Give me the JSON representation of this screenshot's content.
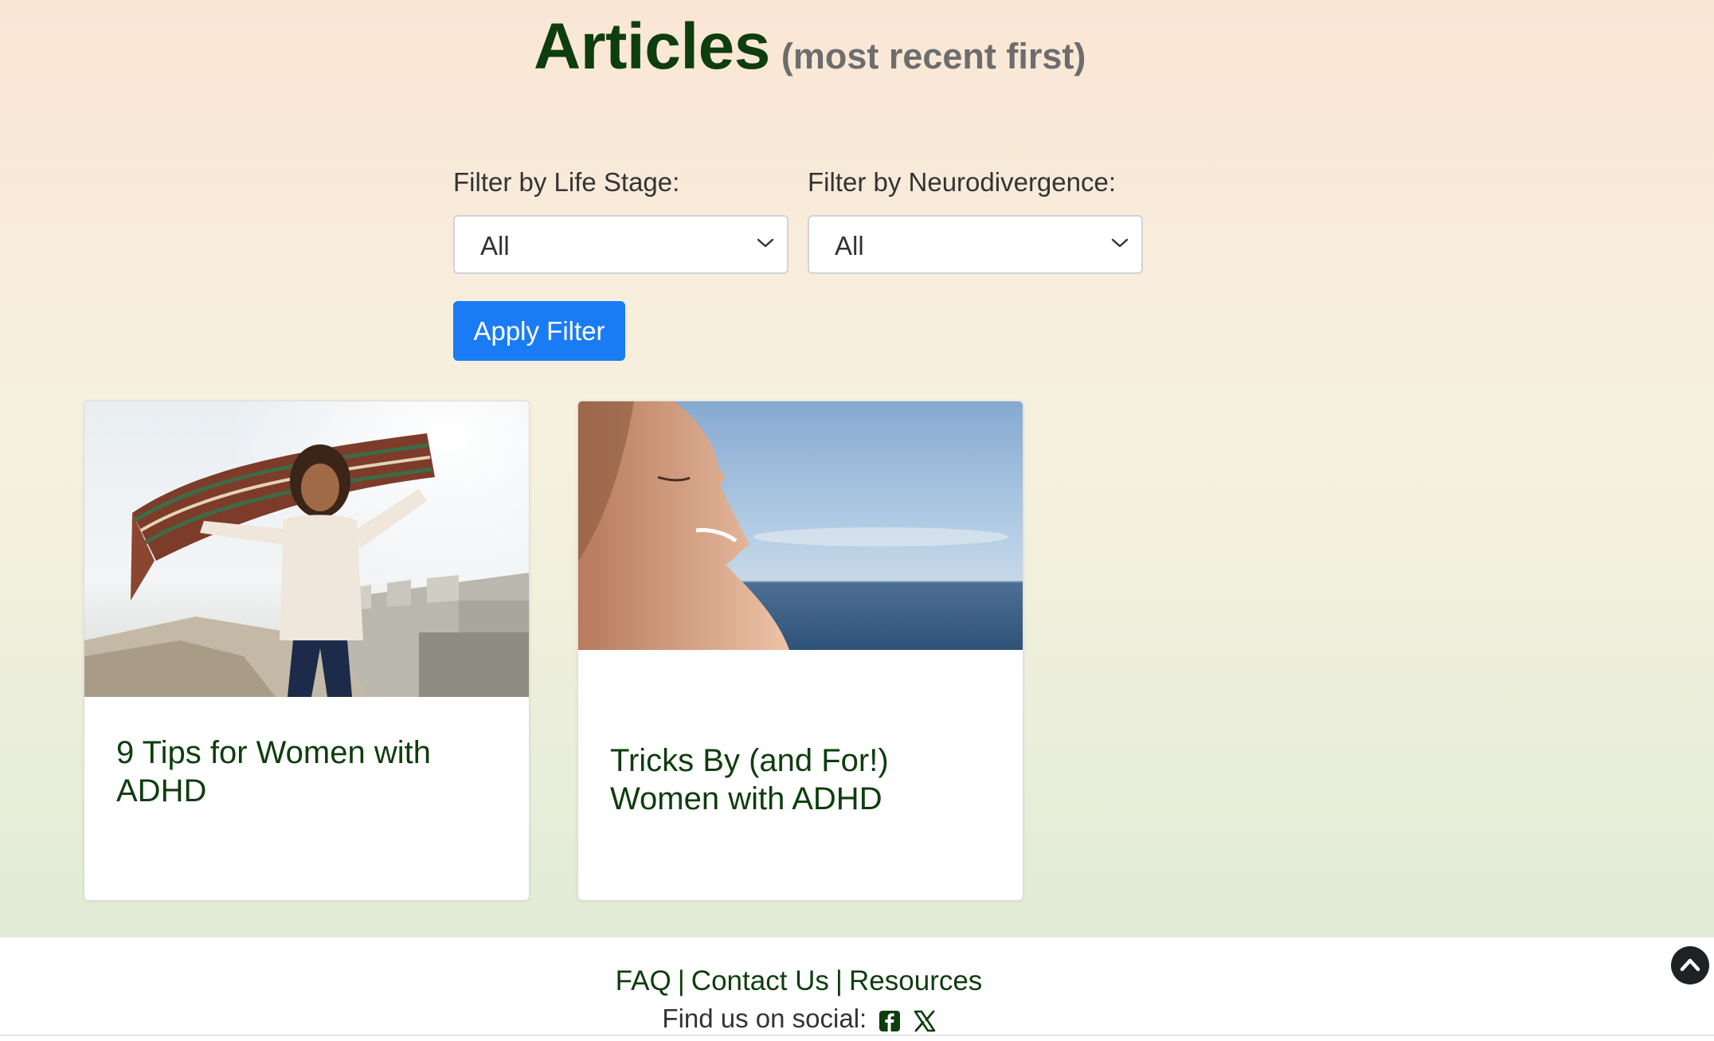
{
  "header": {
    "title": "Articles",
    "subtitle": "(most recent first)"
  },
  "filters": {
    "life_stage": {
      "label": "Filter by Life Stage:",
      "selected": "All"
    },
    "neurodivergence": {
      "label": "Filter by Neurodivergence:",
      "selected": "All"
    },
    "apply_label": "Apply Filter"
  },
  "articles": [
    {
      "title": "9 Tips for Women with ADHD",
      "image": "woman-with-scarf-on-cliff-photo"
    },
    {
      "title": "Tricks By (and For!) Women with ADHD",
      "image": "woman-face-sky-sea-photo"
    }
  ],
  "footer": {
    "links": [
      "FAQ",
      "Contact Us",
      "Resources"
    ],
    "social_label": "Find us on social:",
    "social_icons": [
      "facebook-icon",
      "x-icon"
    ]
  },
  "colors": {
    "heading": "#0e3d0e",
    "accent_button": "#1a7cf5"
  }
}
